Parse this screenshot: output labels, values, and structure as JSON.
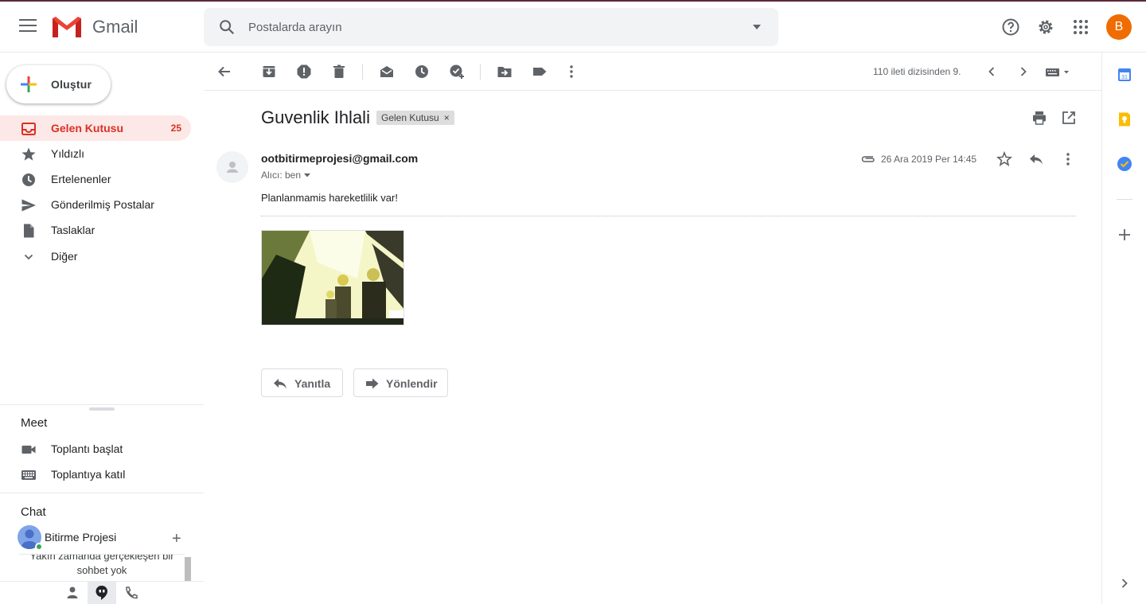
{
  "header": {
    "brand": "Gmail",
    "search_placeholder": "Postalarda arayın",
    "avatar_initial": "B"
  },
  "sidebar": {
    "compose_label": "Oluştur",
    "items": [
      {
        "label": "Gelen Kutusu",
        "count": "25",
        "icon": "inbox-icon",
        "active": true
      },
      {
        "label": "Yıldızlı",
        "icon": "star-icon"
      },
      {
        "label": "Ertelenenler",
        "icon": "clock-icon"
      },
      {
        "label": "Gönderilmiş Postalar",
        "icon": "send-icon"
      },
      {
        "label": "Taslaklar",
        "icon": "draft-icon"
      },
      {
        "label": "Diğer",
        "icon": "chevron-down-icon"
      }
    ],
    "meet": {
      "title": "Meet",
      "start_label": "Toplantı başlat",
      "join_label": "Toplantıya katıl"
    },
    "chat": {
      "title": "Chat",
      "user_name": "Bitirme Projesi",
      "empty_text": "Yakın zamanda gerçekleşen bir sohbet yok"
    }
  },
  "toolbar": {
    "pager_text": "110 ileti dizisinden 9."
  },
  "email": {
    "subject": "Guvenlik Ihlali",
    "label_chip": "Gelen Kutusu",
    "label_remove": "×",
    "sender": "ootbitirmeprojesi@gmail.com",
    "recipient": "Alıcı: ben",
    "date": "26 Ara 2019 Per 14:45",
    "body": "Planlanmamis hareketlilik var!",
    "reply_label": "Yanıtla",
    "forward_label": "Yönlendir"
  },
  "colors": {
    "accent_red": "#d93025",
    "active_bg": "#fce8e6",
    "avatar_orange": "#ef6c00"
  }
}
